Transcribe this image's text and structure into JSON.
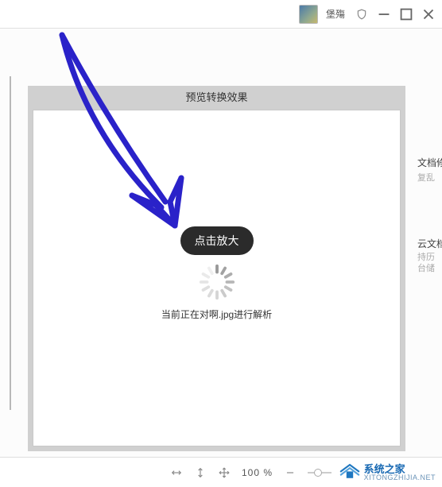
{
  "titlebar": {
    "username": "堡殤"
  },
  "preview": {
    "title": "预览转换效果",
    "tooltip": "点击放大",
    "status": "当前正在对啊.jpg进行解析"
  },
  "side1": {
    "title": "文档修",
    "sub": "复乱"
  },
  "side2": {
    "title": "云文档",
    "sub": "持历\n台储"
  },
  "statusbar": {
    "zoom": "100 %"
  },
  "watermark": {
    "line1": "系统之家",
    "line2": "XITONGZHIJIA.NET"
  }
}
